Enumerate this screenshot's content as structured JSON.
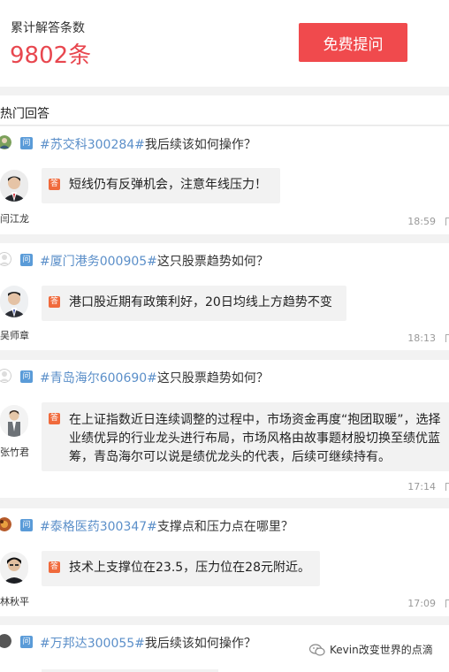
{
  "header": {
    "count_label": "累计解答条数",
    "count_value": "9802条",
    "ask_button": "免费提问"
  },
  "section": {
    "title": "热门回答"
  },
  "tags": {
    "question": "问",
    "answer": "答"
  },
  "cards": [
    {
      "stock": "#苏交科300284#",
      "question": "我后续该如何操作？",
      "advisor": "闫江龙",
      "answer_lines": [
        "短线仍有反弹机会，注意年线压力！"
      ],
      "time": "18:59"
    },
    {
      "stock": "#厦门港务000905#",
      "question": "这只股票趋势如何？",
      "advisor": "吴师章",
      "answer_lines": [
        "港口股近期有政策利好，20日均线上方趋势不变"
      ],
      "time": "18:13"
    },
    {
      "stock": "#青岛海尔600690#",
      "question": "这只股票趋势如何？",
      "advisor": "张竹君",
      "answer_lines": [
        "在上证指数近日连续调整的过程中，市场资金再度“抱团取暖”，选择",
        "业绩优异的行业龙头进行布局，市场风格由故事题材股切换至绩优蓝",
        "筹，青岛海尔可以说是绩优龙头的代表，后续可继续持有。"
      ],
      "time": "17:14"
    },
    {
      "stock": "#泰格医药300347#",
      "question": "支撑点和压力点在哪里？",
      "advisor": "林秋平",
      "answer_lines": [
        "技术上支撑位在23.5，压力位在28元附近。"
      ],
      "time": "17:09"
    },
    {
      "stock": "#万邦达300055#",
      "question": "我后续该如何操作？"
    }
  ],
  "watermark": {
    "text": "Kevin改变世界的点滴"
  }
}
